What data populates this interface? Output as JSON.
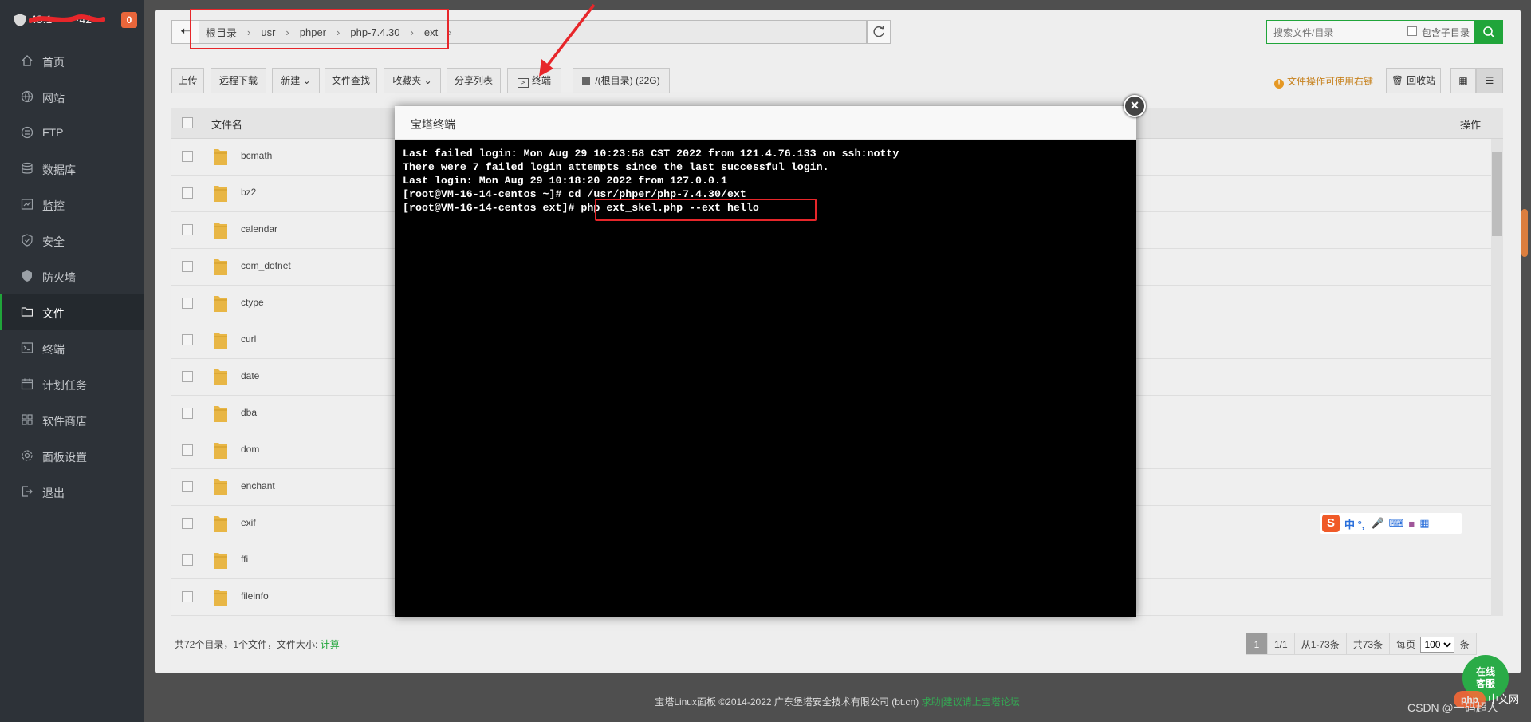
{
  "sidebar": {
    "host_name": "43.1 · · · ·42",
    "badge": "0",
    "items": [
      {
        "label": "首页",
        "icon": "home-icon"
      },
      {
        "label": "网站",
        "icon": "globe-icon"
      },
      {
        "label": "FTP",
        "icon": "ftp-icon"
      },
      {
        "label": "数据库",
        "icon": "database-icon"
      },
      {
        "label": "监控",
        "icon": "monitor-icon"
      },
      {
        "label": "安全",
        "icon": "shield-icon"
      },
      {
        "label": "防火墙",
        "icon": "firewall-icon"
      },
      {
        "label": "文件",
        "icon": "folder-icon",
        "active": true
      },
      {
        "label": "终端",
        "icon": "terminal-icon"
      },
      {
        "label": "计划任务",
        "icon": "calendar-icon"
      },
      {
        "label": "软件商店",
        "icon": "grid-icon"
      },
      {
        "label": "面板设置",
        "icon": "gear-icon"
      },
      {
        "label": "退出",
        "icon": "logout-icon"
      }
    ]
  },
  "path": {
    "crumbs": [
      "根目录",
      "usr",
      "phper",
      "php-7.4.30",
      "ext"
    ]
  },
  "search": {
    "placeholder": "搜索文件/目录",
    "sub_label": "包含子目录"
  },
  "toolbar": {
    "upload": "上传",
    "remote_download": "远程下载",
    "new": "新建",
    "file_search": "文件查找",
    "favorites": "收藏夹",
    "share_list": "分享列表",
    "terminal": "终端",
    "disk": "/(根目录) (22G)",
    "tip": "文件操作可使用右键",
    "recycle": "回收站"
  },
  "table": {
    "col_name": "文件名",
    "col_op": "操作",
    "rows": [
      "bcmath",
      "bz2",
      "calendar",
      "com_dotnet",
      "ctype",
      "curl",
      "date",
      "dba",
      "dom",
      "enchant",
      "exif",
      "ffi",
      "fileinfo"
    ]
  },
  "status": {
    "summary": "共72个目录，1个文件，文件大小:",
    "calc": "计算"
  },
  "pager": {
    "current": "1",
    "pages": "1/1",
    "range": "从1-73条",
    "total": "共73条",
    "per_page_label": "每页",
    "per_page": "100",
    "suffix": "条"
  },
  "modal": {
    "title": "宝塔终端",
    "lines": [
      "Last failed login: Mon Aug 29 10:23:58 CST 2022 from 121.4.76.133 on ssh:notty",
      "There were 7 failed login attempts since the last successful login.",
      "Last login: Mon Aug 29 10:18:20 2022 from 127.0.0.1",
      "[root@VM-16-14-centos ~]# cd /usr/phper/php-7.4.30/ext",
      "[root@VM-16-14-centos ext]# php ext_skel.php --ext hello"
    ]
  },
  "footer": {
    "copyright": "宝塔Linux面板 ©2014-2022 广东堡塔安全技术有限公司 (bt.cn)",
    "link": "求助|建议请上宝塔论坛"
  },
  "ime": {
    "text": "中 °,"
  },
  "online_service": "在线客服",
  "watermark": "CSDN @一码超人",
  "php_badge": "php",
  "php_text": "中文网",
  "colors": {
    "accent": "#20a53a",
    "sidebar": "#2d3238",
    "highlight": "#e7262a"
  }
}
